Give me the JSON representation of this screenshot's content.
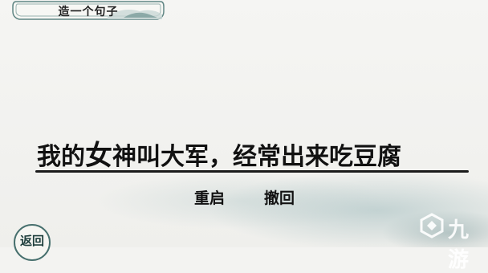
{
  "header": {
    "title": "造一个句子"
  },
  "sentence": {
    "part1": "我的",
    "part2": "女",
    "part3": "神叫大军，经常出来吃豆腐"
  },
  "actions": {
    "restart_label": "重启",
    "undo_label": "撤回"
  },
  "back": {
    "label": "返回"
  },
  "watermark": {
    "text": "九游"
  },
  "colors": {
    "accent": "#47706e",
    "ink": "#111111",
    "paper": "#f3f3f1"
  }
}
